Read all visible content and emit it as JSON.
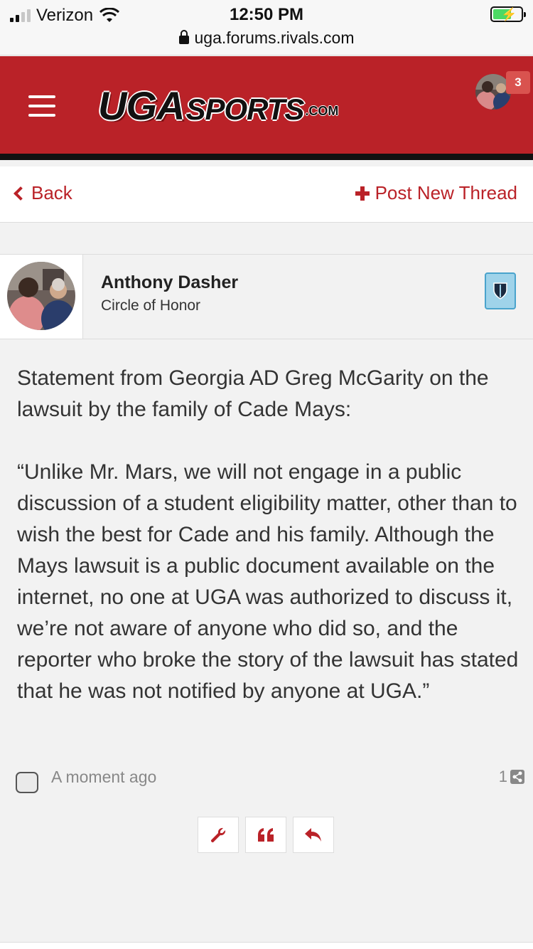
{
  "status_bar": {
    "carrier": "Verizon",
    "time": "12:50 PM",
    "url": "uga.forums.rivals.com"
  },
  "header": {
    "logo": {
      "part1": "UGA",
      "part2": "SPORTS",
      "part3": ".COM"
    },
    "notification_count": "3",
    "brand_color": "#ba2228"
  },
  "nav": {
    "back_label": "Back",
    "post_new_label": "Post New Thread"
  },
  "post": {
    "author_name": "Anthony Dasher",
    "author_title": "Circle of Honor",
    "paragraphs": [
      "Statement from Georgia AD Greg McGarity on the lawsuit by the family of Cade Mays:",
      "“Unlike Mr. Mars, we will not engage in a public discussion of a student eligibility matter, other than to wish the best for Cade and his family. Although the Mays lawsuit is a public document available on the internet, no one at UGA was authorized to discuss it, we’re not aware of anyone who did so, and the reporter who broke the story of the lawsuit has stated that he was not notified by anyone at UGA.”"
    ],
    "timestamp": "A moment ago",
    "post_number": "1"
  },
  "actions": {
    "icons": [
      "wrench-icon",
      "quote-icon",
      "reply-icon"
    ]
  }
}
